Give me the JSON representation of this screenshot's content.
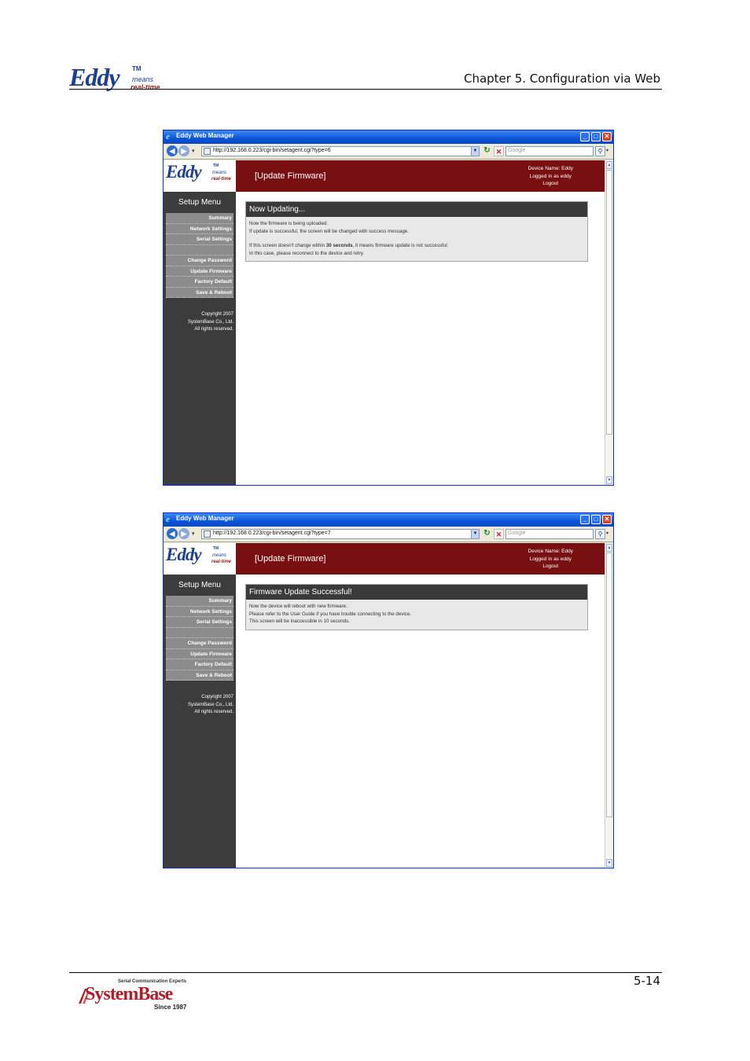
{
  "document": {
    "chapter_title": "Chapter 5. Configuration via Web",
    "page_number": "5-14",
    "header_logo": {
      "name": "Eddy",
      "tm": "TM",
      "means": "means",
      "real_time": "real-time"
    },
    "footer_logo": {
      "tagline": "Serial Communication Experts",
      "name": "SystemBase",
      "since": "Since 1987"
    }
  },
  "screenshots": [
    {
      "window_title": "Eddy Web Manager",
      "url": "http://192.168.0.223/cgi-bin/setagent.cgi?type=6",
      "search_placeholder": "Google",
      "app_logo": {
        "name": "Eddy",
        "tm": "TM",
        "means": "means",
        "real_time": "real-time"
      },
      "page_heading": "[Update Firmware]",
      "user_info": [
        "Device Name: Eddy",
        "Logged in as eddy",
        "Logout"
      ],
      "setup_menu": "Setup Menu",
      "menu": [
        "Summary",
        "Network Settings",
        "Serial Settings",
        "",
        "Change Password",
        "Update Firmware",
        "Factory Default",
        "Save & Reboot"
      ],
      "copyright": [
        "Copyright 2007",
        "SystemBase Co., Ltd.",
        "All rights reserved."
      ],
      "panel_title": "Now Updating...",
      "panel_lines": {
        "line1": "Now the firmware is being uploaded.",
        "line2": "If update is successful, the screen will be changed with success message.",
        "line3_pre": "If this screen doesn't change within ",
        "line3_bold": "30 seconds",
        "line3_post": ", it means firmware update is not successful.",
        "line4": "In this case, please reconnect to the device and retry."
      }
    },
    {
      "window_title": "Eddy Web Manager",
      "url": "http://192.168.0.223/cgi-bin/setagent.cgi?type=7",
      "search_placeholder": "Google",
      "app_logo": {
        "name": "Eddy",
        "tm": "TM",
        "means": "means",
        "real_time": "real-time"
      },
      "page_heading": "[Update Firmware]",
      "user_info": [
        "Device Name: Eddy",
        "Logged in as eddy",
        "Logout"
      ],
      "setup_menu": "Setup Menu",
      "menu": [
        "Summary",
        "Network Settings",
        "Serial Settings",
        "",
        "Change Password",
        "Update Firmware",
        "Factory Default",
        "Save & Reboot"
      ],
      "copyright": [
        "Copyright 2007",
        "SystemBase Co., Ltd.",
        "All rights reserved."
      ],
      "panel_title": "Firmware Update Successful!",
      "panel_lines": [
        "Now the device will reboot with new firmware.",
        "Please refer to the User Guide if you have trouble connecting to the device.",
        "This screen will be inaccessible in 10 seconds."
      ]
    }
  ],
  "colors": {
    "app_header": "#780f10",
    "sidebar": "#3c3c3c",
    "menu_item": "#8c8c8c",
    "brand_blue": "#1d3f8f",
    "xp_title": "#0a53d8"
  }
}
